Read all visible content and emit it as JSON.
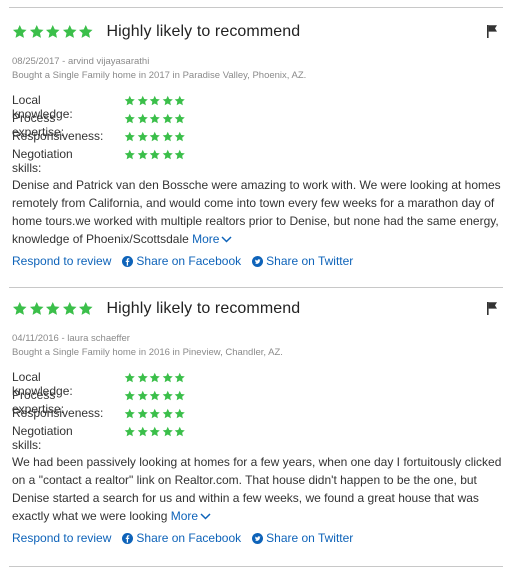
{
  "colors": {
    "star": "#3bbf4a",
    "link": "#0e63b9",
    "rule": "#c8c8c8"
  },
  "reviews": [
    {
      "stars": 5,
      "headline": "Highly likely to recommend",
      "date_author": "08/25/2017 - arvind vijayasarathi",
      "purchase": "Bought a Single Family home in 2017 in Paradise Valley, Phoenix, AZ.",
      "ratings": [
        {
          "label": "Local knowledge:",
          "stars": 5
        },
        {
          "label": "Process expertise:",
          "stars": 5
        },
        {
          "label": "Responsiveness:",
          "stars": 5
        },
        {
          "label": "Negotiation skills:",
          "stars": 5
        }
      ],
      "body": "Denise and Patrick van den Bossche were amazing to work with. We were looking at homes remotely from California, and would come into town every few weeks for a marathon day of home tours.we worked with multiple realtors prior to Denise, but none had the same energy, knowledge of Phoenix/Scottsdale",
      "more_label": "More",
      "respond_label": "Respond to review",
      "facebook_label": "Share on Facebook",
      "twitter_label": "Share on Twitter"
    },
    {
      "stars": 5,
      "headline": "Highly likely to recommend",
      "date_author": "04/11/2016 - laura schaeffer",
      "purchase": "Bought a Single Family home in 2016 in Pineview, Chandler, AZ.",
      "ratings": [
        {
          "label": "Local knowledge:",
          "stars": 5
        },
        {
          "label": "Process expertise:",
          "stars": 5
        },
        {
          "label": "Responsiveness:",
          "stars": 5
        },
        {
          "label": "Negotiation skills:",
          "stars": 5
        }
      ],
      "body": "We had been passively looking at homes for a few years, when one day I fortuitously clicked on a \"contact a realtor\" link on Realtor.com. That house didn't happen to be the one, but Denise started a search for us and within a few weeks, we found a great house that was exactly what we were looking",
      "more_label": "More",
      "respond_label": "Respond to review",
      "facebook_label": "Share on Facebook",
      "twitter_label": "Share on Twitter"
    }
  ]
}
